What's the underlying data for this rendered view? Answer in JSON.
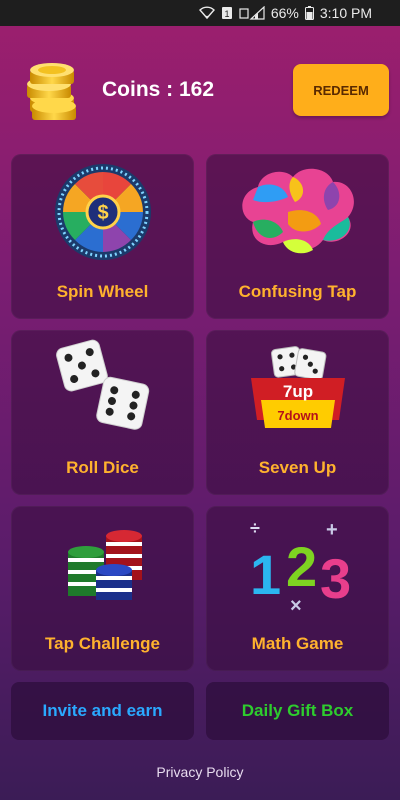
{
  "status_bar": {
    "battery": "66%",
    "time": "3:10 PM",
    "icons": [
      "wifi-icon",
      "notification-icon",
      "signal-icon",
      "battery-icon"
    ]
  },
  "header": {
    "coins_text": "Coins : 162",
    "redeem_label": "REDEEM"
  },
  "cards": [
    {
      "label": "Spin Wheel",
      "icon": "spin-wheel-icon"
    },
    {
      "label": "Confusing Tap",
      "icon": "brain-icon"
    },
    {
      "label": "Roll Dice",
      "icon": "dice-icon"
    },
    {
      "label": "Seven Up",
      "icon": "seven-up-icon",
      "art_text": [
        "7up",
        "7down"
      ]
    },
    {
      "label": "Tap Challenge",
      "icon": "poker-chips-icon"
    },
    {
      "label": "Math Game",
      "icon": "math-numbers-icon",
      "art_text": [
        "1",
        "2",
        "3",
        "÷",
        "+",
        "×"
      ]
    }
  ],
  "buttons": {
    "invite": {
      "label": "Invite and earn",
      "color": "#2aa9ff"
    },
    "daily_gift": {
      "label": "Daily Gift Box",
      "color": "#2ecc2e"
    }
  },
  "footer": {
    "privacy": "Privacy Policy"
  },
  "colors": {
    "accent": "#ffae1a",
    "card_title": "#ffb22e"
  }
}
